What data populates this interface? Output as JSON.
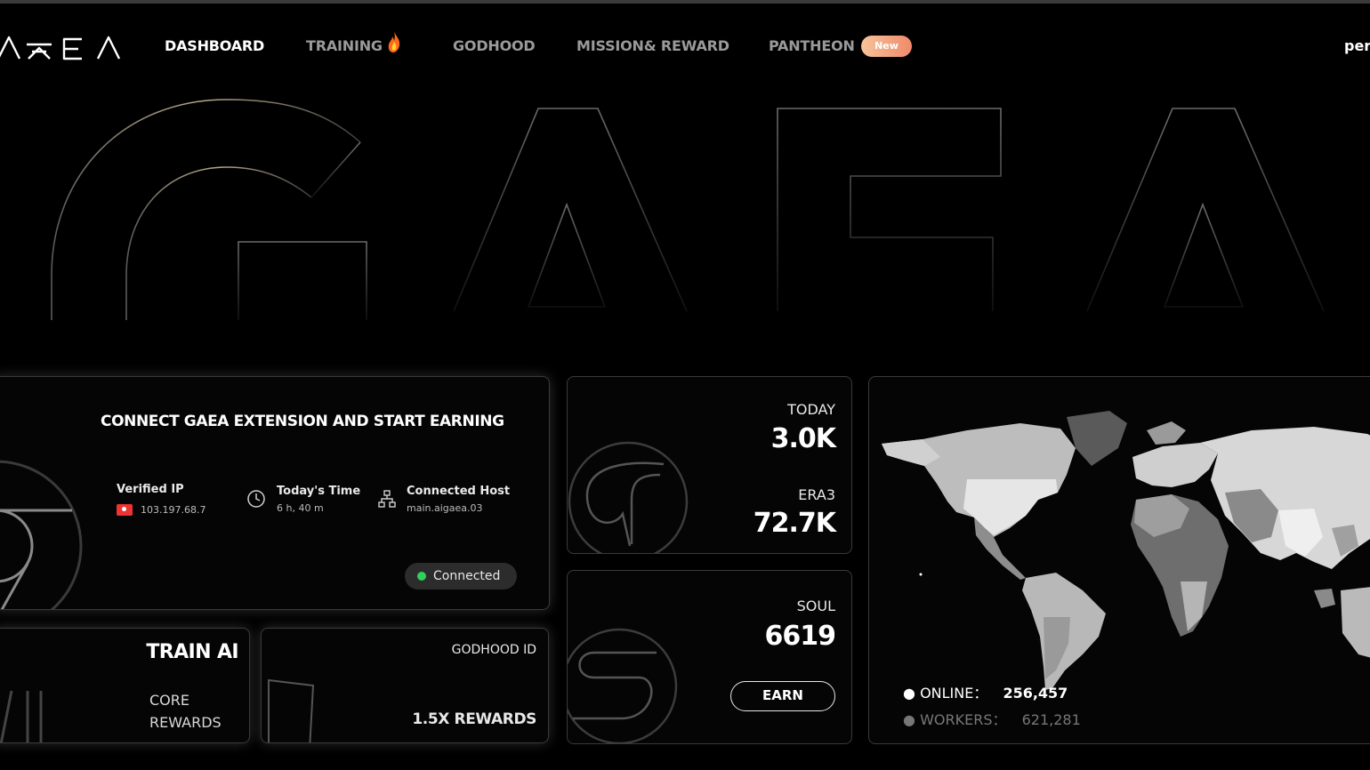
{
  "nav": {
    "logo_text": "AEA",
    "items": [
      {
        "label": "DASHBOARD",
        "active": true
      },
      {
        "label": "TRAINING",
        "active": false
      },
      {
        "label": "GODHOOD",
        "active": false
      },
      {
        "label": "MISSION& REWARD",
        "active": false
      },
      {
        "label": "PANTHEON",
        "active": false
      }
    ],
    "new_badge": "New",
    "user_partial": "per"
  },
  "hero": {
    "watermark": "GAEA"
  },
  "connect": {
    "title": "CONNECT GAEA EXTENSION AND START EARNING",
    "verified_ip_label": "Verified IP",
    "verified_ip_value": "103.197.68.7",
    "todays_time_label": "Today's Time",
    "todays_time_value": "6 h, 40 m",
    "host_label": "Connected Host",
    "host_value": "main.aigaea.03",
    "status": "Connected",
    "status_color": "#2fd15b"
  },
  "train": {
    "title": "TRAIN AI",
    "line1": "CORE",
    "line2": "REWARDS"
  },
  "godhood": {
    "title": "GODHOOD ID",
    "rewards": "1.5X REWARDS"
  },
  "stats": {
    "today_label": "TODAY",
    "today_value": "3.0K",
    "era_label": "ERA3",
    "era_value": "72.7K"
  },
  "soul": {
    "label": "SOUL",
    "value": "6619",
    "earn_label": "EARN"
  },
  "map": {
    "online_label": "ONLINE：",
    "online_value": "256,457",
    "workers_label": "WORKERS：",
    "workers_value": "621,281"
  }
}
